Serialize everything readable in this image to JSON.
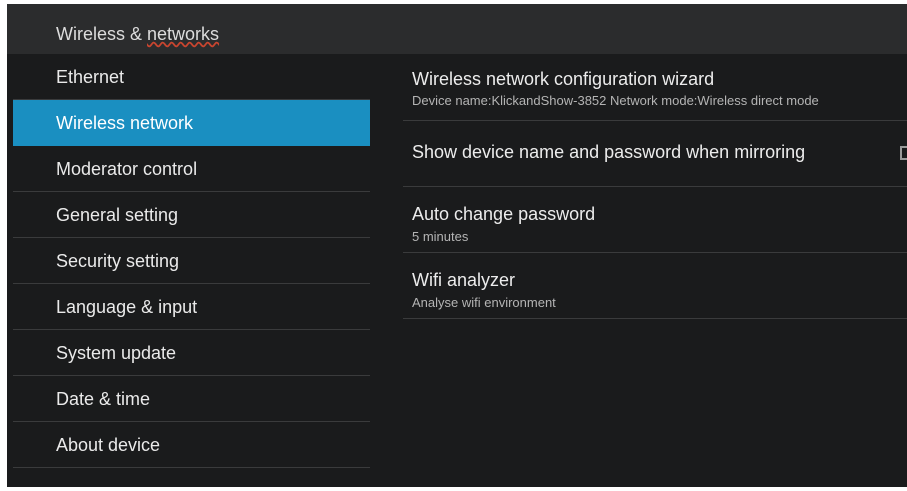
{
  "header": {
    "title_prefix": "Wireless & ",
    "title_underlined": "networks"
  },
  "sidebar": {
    "items": [
      {
        "label": "Ethernet"
      },
      {
        "label": "Wireless network",
        "selected": true
      },
      {
        "label": "Moderator control"
      },
      {
        "label": "General setting"
      },
      {
        "label": "Security setting"
      },
      {
        "label": "Language & input"
      },
      {
        "label": "System update"
      },
      {
        "label": "Date & time"
      },
      {
        "label": "About device"
      }
    ]
  },
  "settings": {
    "config_wizard": {
      "title": "Wireless network configuration wizard",
      "summary": "Device name:KlickandShow-3852   Network mode:Wireless direct mode"
    },
    "show_device_name": {
      "title": "Show device name and password when mirroring",
      "checked": false
    },
    "auto_change_password": {
      "title": "Auto change password",
      "summary": "5 minutes"
    },
    "wifi_analyzer": {
      "title": "Wifi analyzer",
      "summary": "Analyse wifi environment"
    }
  },
  "colors": {
    "background": "#1a1b1c",
    "titlebar": "#2b2c2d",
    "accent": "#1a8fc1",
    "divider": "#3a3b3c"
  }
}
